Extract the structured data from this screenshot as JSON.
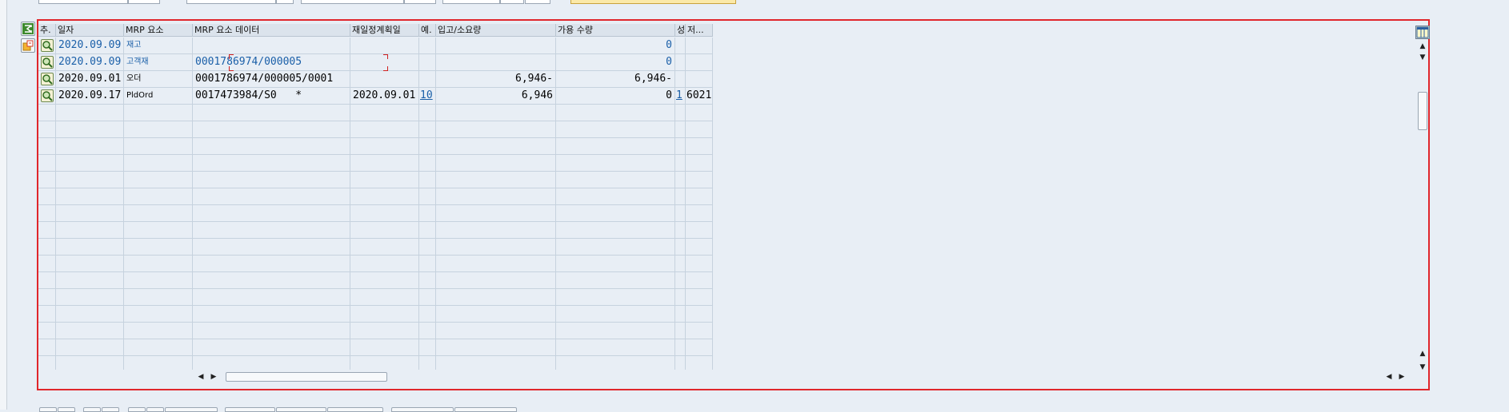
{
  "grid": {
    "columns": [
      "추.",
      "일자",
      "MRP 요소",
      "MRP 요소 데이터",
      "재일정계획일",
      "예.",
      "입고/소요량",
      "가용 수량",
      "성",
      "저..."
    ],
    "rows": [
      {
        "date": "2020.09.09",
        "element": "재고",
        "element_data": "",
        "reschedule_date": "",
        "exception": "",
        "receipt_req": "",
        "available_qty": "0",
        "status": "",
        "storage": ""
      },
      {
        "date": "2020.09.09",
        "element": "고객재",
        "element_data": "0001786974/000005",
        "reschedule_date": "",
        "exception": "",
        "receipt_req": "",
        "available_qty": "0",
        "status": "",
        "storage": ""
      },
      {
        "date": "2020.09.01",
        "element": "오더",
        "element_data": "0001786974/000005/0001",
        "reschedule_date": "",
        "exception": "",
        "receipt_req": "6,946-",
        "available_qty": "6,946-",
        "status": "",
        "storage": ""
      },
      {
        "date": "2020.09.17",
        "element": "PldOrd",
        "element_data": "0017473984/S0   *",
        "reschedule_date": "2020.09.01",
        "exception": "10",
        "receipt_req": "6,946",
        "available_qty": "0",
        "status": "1",
        "storage": "6021"
      }
    ]
  },
  "icons": {
    "sum": "sum-icon",
    "layout": "layout-icon",
    "details": "details-icon",
    "row_detail": "magnifier-icon"
  },
  "colors": {
    "frame_border": "#e0262b",
    "link_blue": "#1a5fa8",
    "header_bg": "#dbe3ec",
    "grid_bg": "#e8eef5"
  }
}
